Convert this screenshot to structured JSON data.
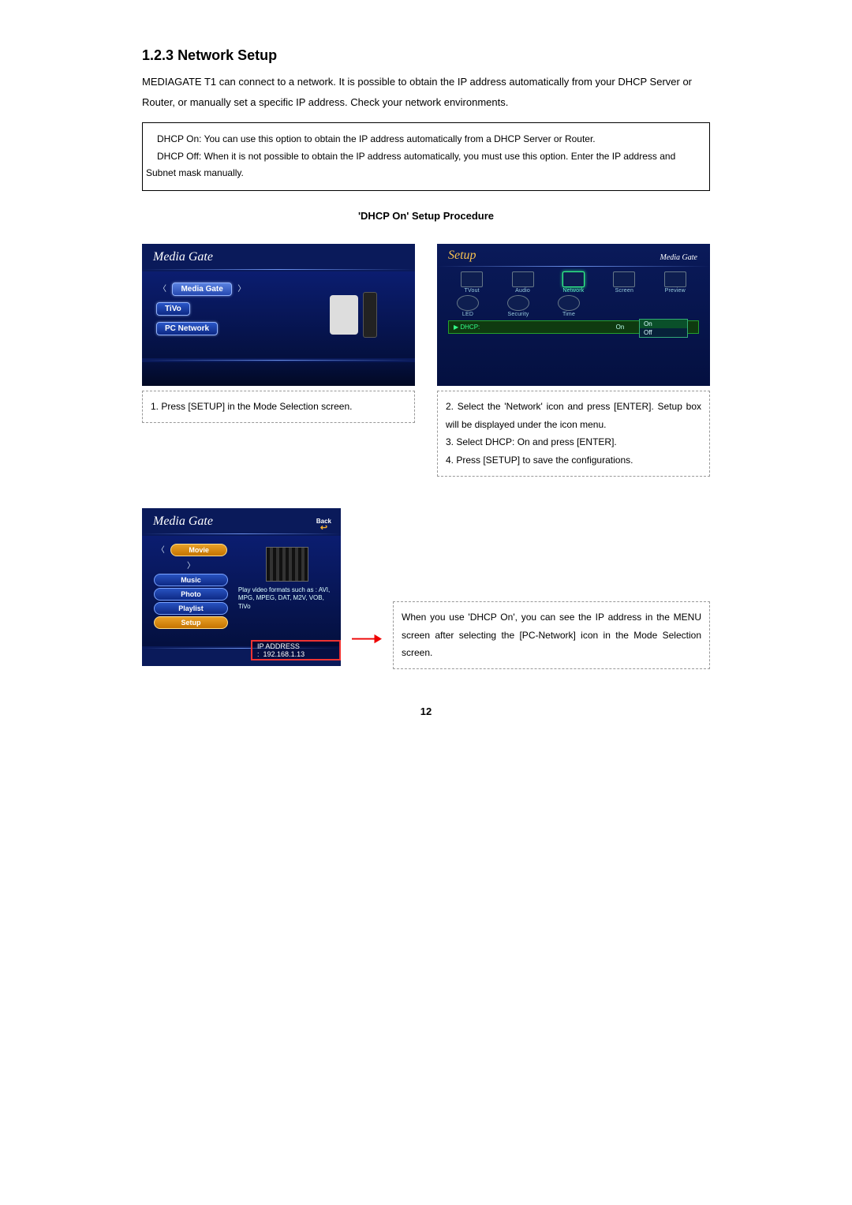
{
  "section": {
    "number": "1.2.3",
    "title": "Network Setup",
    "intro": "MEDIAGATE T1 can connect to a network. It is possible to obtain the IP address automatically from your DHCP Server or Router, or manually set a specific IP address. Check your network environments."
  },
  "info_box": {
    "dhcp_on": "DHCP On: You can use this option to obtain the IP address automatically from a DHCP Server or Router.",
    "dhcp_off": "DHCP Off: When it is not possible to obtain the IP address automatically, you must use this option. Enter the IP address and Subnet mask manually."
  },
  "procedure_heading": "'DHCP On' Setup Procedure",
  "screenshot1": {
    "brand": "Media Gate",
    "buttons": {
      "media_gate": "Media Gate",
      "tivo": "TiVo",
      "pc_network": "PC Network"
    }
  },
  "caption1": "1. Press [SETUP] in the Mode Selection screen.",
  "screenshot2": {
    "title": "Setup",
    "brand": "Media Gate",
    "icons_row1": [
      "TVout",
      "Audio",
      "Network",
      "Screen",
      "Preview"
    ],
    "icons_row2": [
      "LED",
      "Security",
      "Time"
    ],
    "dhcp_label": "DHCP:",
    "dhcp_value": "On",
    "options": {
      "on": "On",
      "off": "Off"
    }
  },
  "caption2": {
    "l1": "2. Select the 'Network' icon and press [ENTER]. Setup box will be displayed under the icon menu.",
    "l2": "3. Select DHCP: On and press [ENTER].",
    "l3": "4. Press [SETUP] to save the configurations."
  },
  "screenshot3": {
    "brand": "Media Gate",
    "back": "Back",
    "menu": {
      "movie": "Movie",
      "music": "Music",
      "photo": "Photo",
      "playlist": "Playlist",
      "setup": "Setup"
    },
    "desc": "Play video formats such as : AVI, MPG, MPEG, DAT, M2V, VOB, TiVo",
    "ip_label": "IP ADDRESS :",
    "ip_value": "192.168.1.13"
  },
  "caption3": "When you use 'DHCP On', you can see the IP address in the MENU screen after selecting the [PC-Network] icon in the Mode Selection screen.",
  "page_number": "12"
}
